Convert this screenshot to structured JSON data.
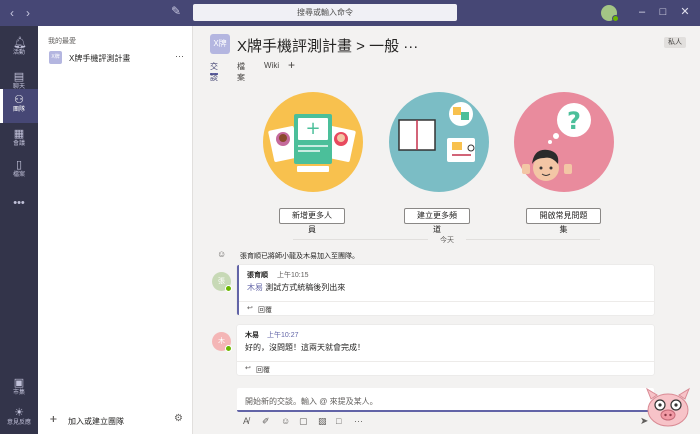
{
  "titlebar": {
    "search_placeholder": "搜尋或輸入命令",
    "back_icon": "chevron-left-icon",
    "forward_icon": "chevron-right-icon"
  },
  "rail": {
    "items": [
      {
        "label": "活動",
        "icon": "bell-icon"
      },
      {
        "label": "聊天",
        "icon": "chat-icon"
      },
      {
        "label": "團隊",
        "icon": "teams-icon"
      },
      {
        "label": "會議",
        "icon": "calendar-icon"
      },
      {
        "label": "檔案",
        "icon": "file-icon"
      }
    ],
    "bottom_items": [
      {
        "label": "市集",
        "icon": "store-icon"
      },
      {
        "label": "意見反應",
        "icon": "lightbulb-icon"
      }
    ]
  },
  "sidebar": {
    "favorites_heading": "我的最愛",
    "team": {
      "avatar_text": "X牌",
      "name": "X牌手機評測計畫"
    },
    "join_label": "加入或建立團隊"
  },
  "channel": {
    "avatar_text": "X牌",
    "title": "X牌手機評測計畫 > 一般 ···",
    "private_label": "私人",
    "tabs": [
      "交談",
      "檔案",
      "Wiki"
    ]
  },
  "actions": [
    "新增更多人員",
    "建立更多頻道",
    "開啟常見問題集"
  ],
  "divider_label": "今天",
  "system_message": "張育順已將師小龍及木易加入至團隊。",
  "messages": [
    {
      "avatar_text": "張",
      "author": "張育順",
      "time": "上午10:15",
      "mention": "木易",
      "text": " 測試方式統稿後列出來",
      "reply": "回覆"
    },
    {
      "avatar_text": "木",
      "author": "木易",
      "time": "上午10:27",
      "text": "好的，沒問題！這兩天就會完成！",
      "reply": "回覆"
    }
  ],
  "compose": {
    "placeholder": "開始新的交談。輸入 @ 來提及某人。"
  },
  "colors": {
    "brand": "#6264a7",
    "titlebar": "#464775",
    "rail": "#33344a",
    "presence": "#6bb700"
  }
}
